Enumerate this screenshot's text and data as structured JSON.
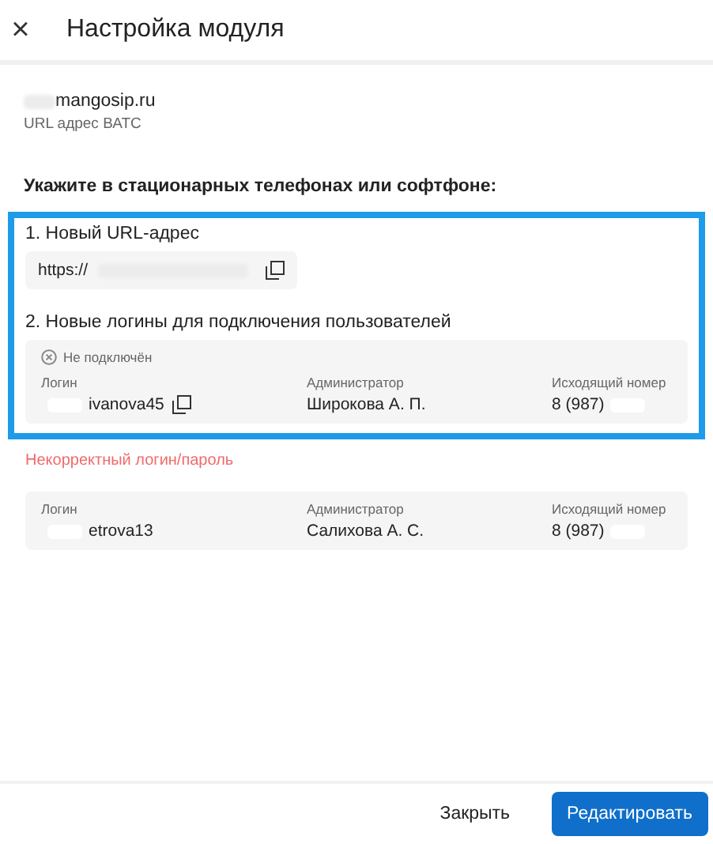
{
  "header": {
    "close_icon": "×",
    "title": "Настройка модуля"
  },
  "pbx": {
    "host": "mangosip.ru",
    "caption": "URL адрес ВАТС"
  },
  "instruction": "Укажите в стационарных телефонах или софтфоне:",
  "highlight": {
    "url_step": "1. Новый URL-адрес",
    "url": "https://",
    "logins_step": "2. Новые логины для подключения пользователей",
    "logins": [
      {
        "status": "Не подключён",
        "columns": [
          "Логин",
          "Администратор",
          "Исходящий номер"
        ],
        "login": "ivanova45",
        "copyable": true,
        "admin": "Широкова А. П.",
        "phone": "8 (987)"
      }
    ]
  },
  "other_logins": [
    {
      "error": "Некорректный логин/пароль",
      "columns": [
        "Логин",
        "Администратор",
        "Исходящий номер"
      ],
      "login": "etrova13",
      "copyable": false,
      "admin": "Салихова А. С.",
      "phone": "8 (987)"
    }
  ],
  "buttons": [
    {
      "label": "Закрыть",
      "kind": "secondary"
    },
    {
      "label": "Редактировать",
      "kind": "primary"
    }
  ]
}
